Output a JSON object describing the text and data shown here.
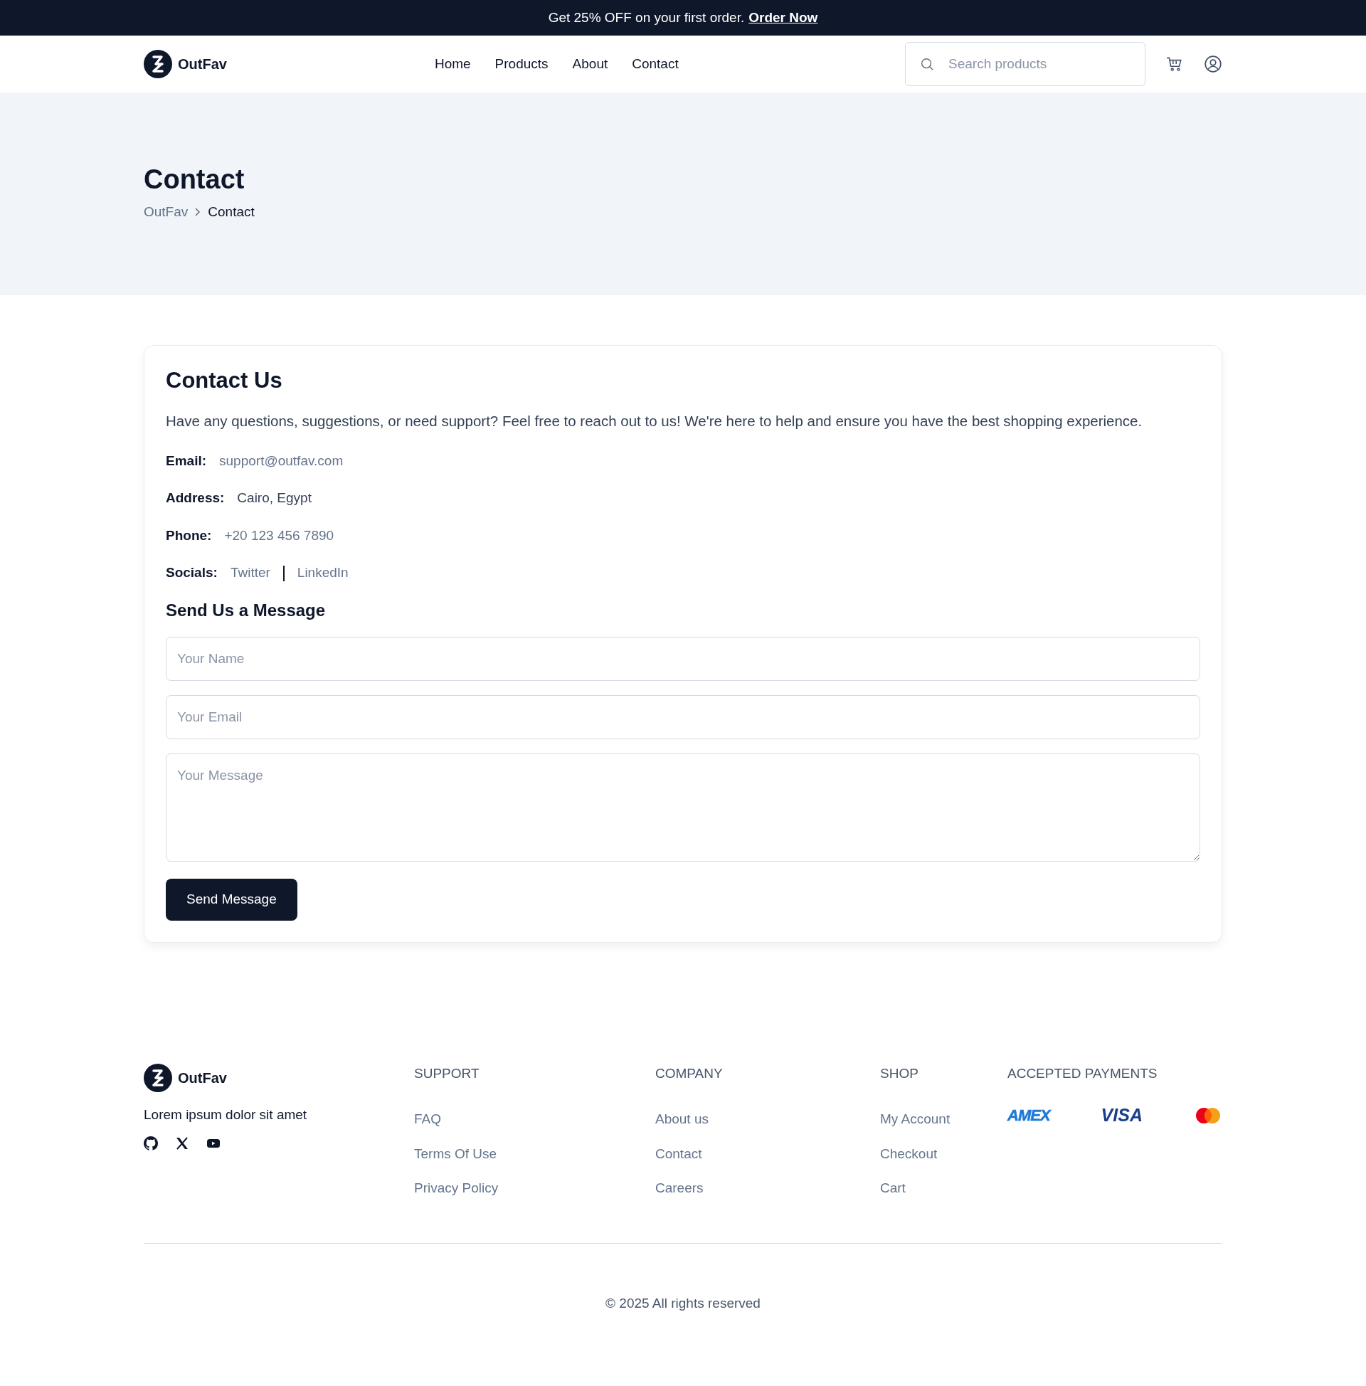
{
  "promo_bar": {
    "text": "Get 25% OFF on your first order.",
    "link": "Order Now"
  },
  "navbar": {
    "brand": "OutFav",
    "links": [
      {
        "label": "Home"
      },
      {
        "label": "Products"
      },
      {
        "label": "About"
      },
      {
        "label": "Contact"
      }
    ],
    "search": {
      "placeholder": "Search products"
    }
  },
  "hero": {
    "title": "Contact",
    "breadcrumb": [
      {
        "label": "OutFav",
        "current": false
      },
      {
        "label": "Contact",
        "current": true
      }
    ]
  },
  "contact_card": {
    "title": "Contact Us",
    "intro": "Have any questions, suggestions, or need support? Feel free to reach out to us! We're here to help and ensure you have the best shopping experience.",
    "details": [
      {
        "label": "Email:",
        "kind": "link",
        "values": [
          "support@outfav.com"
        ]
      },
      {
        "label": "Address:",
        "kind": "text",
        "values": [
          "Cairo, Egypt"
        ]
      },
      {
        "label": "Phone:",
        "kind": "link",
        "values": [
          "+20 123 456 7890"
        ]
      },
      {
        "label": "Socials:",
        "kind": "link",
        "values": [
          "Twitter",
          "LinkedIn"
        ]
      }
    ],
    "form_title": "Send Us a Message",
    "fields": [
      {
        "kind": "input",
        "placeholder": "Your Name"
      },
      {
        "kind": "input",
        "placeholder": "Your Email"
      },
      {
        "kind": "textarea",
        "placeholder": "Your Message"
      }
    ],
    "submit": "Send Message"
  },
  "footer": {
    "brand": "OutFav",
    "tagline": "Lorem ipsum dolor sit amet",
    "socials": [
      {
        "kind": "github"
      },
      {
        "kind": "x"
      },
      {
        "kind": "youtube"
      }
    ],
    "columns": [
      {
        "title": "SUPPORT",
        "links": [
          "FAQ",
          "Terms Of Use",
          "Privacy Policy"
        ]
      },
      {
        "title": "COMPANY",
        "links": [
          "About us",
          "Contact",
          "Careers"
        ]
      },
      {
        "title": "SHOP",
        "links": [
          "My Account",
          "Checkout",
          "Cart"
        ]
      }
    ],
    "payments_title": "ACCEPTED PAYMENTS",
    "payments": [
      {
        "kind": "amex",
        "label": "AMEX"
      },
      {
        "kind": "visa",
        "label": "VISA"
      },
      {
        "kind": "mastercard"
      }
    ],
    "copyright": "© 2025 All rights reserved"
  }
}
